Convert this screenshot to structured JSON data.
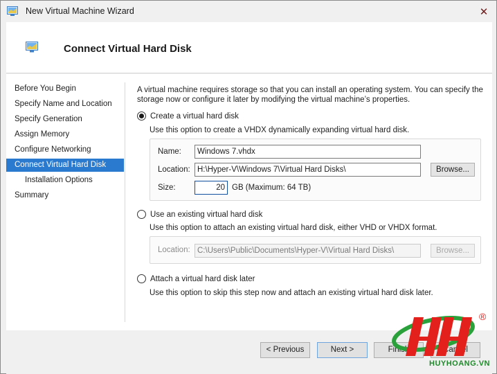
{
  "window": {
    "title": "New Virtual Machine Wizard",
    "close_glyph": "✕"
  },
  "header": {
    "title": "Connect Virtual Hard Disk",
    "icon": "vm-icon"
  },
  "nav": {
    "items": [
      {
        "label": "Before You Begin",
        "active": false,
        "sub": false
      },
      {
        "label": "Specify Name and Location",
        "active": false,
        "sub": false
      },
      {
        "label": "Specify Generation",
        "active": false,
        "sub": false
      },
      {
        "label": "Assign Memory",
        "active": false,
        "sub": false
      },
      {
        "label": "Configure Networking",
        "active": false,
        "sub": false
      },
      {
        "label": "Connect Virtual Hard Disk",
        "active": true,
        "sub": false
      },
      {
        "label": "Installation Options",
        "active": false,
        "sub": true
      },
      {
        "label": "Summary",
        "active": false,
        "sub": false
      }
    ]
  },
  "content": {
    "intro": "A virtual machine requires storage so that you can install an operating system. You can specify the storage now or configure it later by modifying the virtual machine’s properties.",
    "option_create": {
      "label": "Create a virtual hard disk",
      "description": "Use this option to create a VHDX dynamically expanding virtual hard disk.",
      "checked": true,
      "name_label": "Name:",
      "name_value": "Windows 7.vhdx",
      "location_label": "Location:",
      "location_value": "H:\\Hyper-V\\Windows 7\\Virtual Hard Disks\\",
      "browse_label": "Browse...",
      "size_label": "Size:",
      "size_value": "20",
      "size_suffix": "GB (Maximum: 64 TB)"
    },
    "option_existing": {
      "label": "Use an existing virtual hard disk",
      "description": "Use this option to attach an existing virtual hard disk, either VHD or VHDX format.",
      "checked": false,
      "location_label": "Location:",
      "location_value": "C:\\Users\\Public\\Documents\\Hyper-V\\Virtual Hard Disks\\",
      "browse_label": "Browse..."
    },
    "option_later": {
      "label": "Attach a virtual hard disk later",
      "description": "Use this option to skip this step now and attach an existing virtual hard disk later.",
      "checked": false
    }
  },
  "footer": {
    "previous_label": "< Previous",
    "next_label": "Next >",
    "finish_label": "Finish",
    "cancel_label": "Cancel"
  },
  "watermark": {
    "text": "HUYHOANG.VN",
    "registered": "®"
  },
  "colors": {
    "accent": "#2a7ad0",
    "watermark_red": "#e3201b",
    "watermark_green": "#2aa13a"
  }
}
